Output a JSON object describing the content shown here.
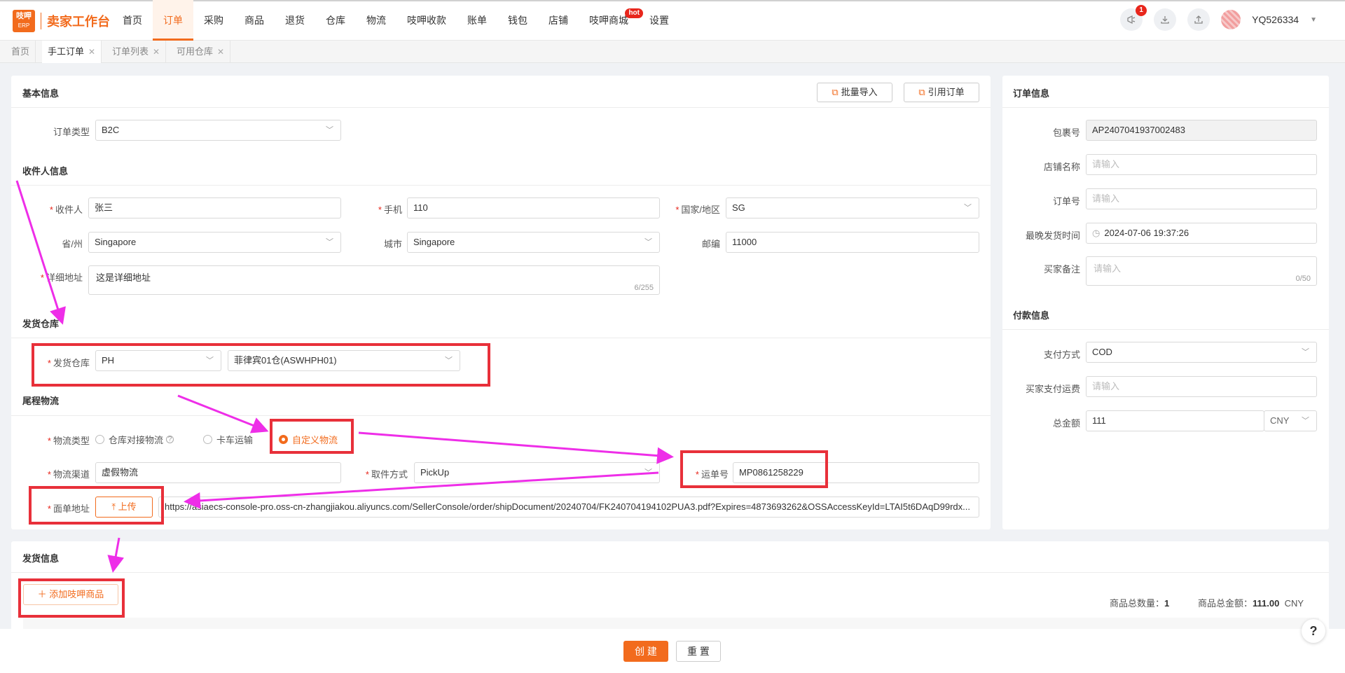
{
  "logo": {
    "badge_top": "吱呷",
    "badge_bottom": "ERP",
    "title": "卖家工作台"
  },
  "nav": [
    {
      "label": "首页"
    },
    {
      "label": "订单",
      "active": true
    },
    {
      "label": "采购"
    },
    {
      "label": "商品"
    },
    {
      "label": "退货"
    },
    {
      "label": "仓库"
    },
    {
      "label": "物流"
    },
    {
      "label": "吱呷收款"
    },
    {
      "label": "账单"
    },
    {
      "label": "钱包"
    },
    {
      "label": "店铺"
    },
    {
      "label": "吱呷商城",
      "badge": "hot"
    },
    {
      "label": "设置"
    }
  ],
  "header": {
    "notification_count": "1",
    "username": "YQ526334"
  },
  "tabs": [
    {
      "label": "首页"
    },
    {
      "label": "手工订单",
      "active": true
    },
    {
      "label": "订单列表"
    },
    {
      "label": "可用仓库"
    }
  ],
  "basic": {
    "title": "基本信息",
    "batch_import": "批量导入",
    "quote_order": "引用订单",
    "order_type_label": "订单类型",
    "order_type_value": "B2C"
  },
  "recipient": {
    "title": "收件人信息",
    "name_label": "收件人",
    "name_value": "张三",
    "phone_label": "手机",
    "phone_value": "110",
    "country_label": "国家/地区",
    "country_value": "SG",
    "province_label": "省/州",
    "province_value": "Singapore",
    "city_label": "城市",
    "city_value": "Singapore",
    "zip_label": "邮编",
    "zip_value": "11000",
    "address_label": "详细地址",
    "address_value": "这是详细地址",
    "address_count": "6/255"
  },
  "warehouse": {
    "title": "发货仓库",
    "label": "发货仓库",
    "country_value": "PH",
    "warehouse_value": "菲律宾01仓(ASWHPH01)"
  },
  "logistics": {
    "title": "尾程物流",
    "type_label": "物流类型",
    "option_warehouse": "仓库对接物流",
    "option_truck": "卡车运输",
    "option_custom": "自定义物流",
    "channel_label": "物流渠道",
    "channel_value": "虚假物流",
    "pickup_label": "取件方式",
    "pickup_value": "PickUp",
    "tracking_label": "运单号",
    "tracking_value": "MP0861258229",
    "waybill_label": "面单地址",
    "upload_label": "上传",
    "waybill_url": "https://asiaecs-console-pro.oss-cn-zhangjiakou.aliyuncs.com/SellerConsole/order/shipDocument/20240704/FK240704194102PUA3.pdf?Expires=4873693262&OSSAccessKeyId=LTAI5t6DAqD99rdx..."
  },
  "order_info": {
    "title": "订单信息",
    "package_label": "包裹号",
    "package_value": "AP2407041937002483",
    "shop_label": "店铺名称",
    "shop_placeholder": "请输入",
    "order_no_label": "订单号",
    "order_no_placeholder": "请输入",
    "latest_ship_label": "最晚发货时间",
    "latest_ship_value": "2024-07-06 19:37:26",
    "buyer_note_label": "买家备注",
    "buyer_note_placeholder": "请输入",
    "buyer_note_count": "0/50"
  },
  "payment": {
    "title": "付款信息",
    "method_label": "支付方式",
    "method_value": "COD",
    "buyer_shipping_label": "买家支付运费",
    "buyer_shipping_placeholder": "请输入",
    "total_label": "总金额",
    "total_value": "111",
    "currency": "CNY"
  },
  "shipping": {
    "title": "发货信息",
    "add_product": "添加吱呷商品",
    "qty_label": "商品总数量：",
    "qty_value": "1",
    "amount_label": "商品总金额：",
    "amount_value": "111.00",
    "amount_currency": "CNY"
  },
  "footer": {
    "create": "创 建",
    "reset": "重 置",
    "help": "?"
  },
  "colors": {
    "accent": "#f26b1d",
    "annotation_box": "#e8303a",
    "annotation_arrow": "#ee2ee8"
  }
}
